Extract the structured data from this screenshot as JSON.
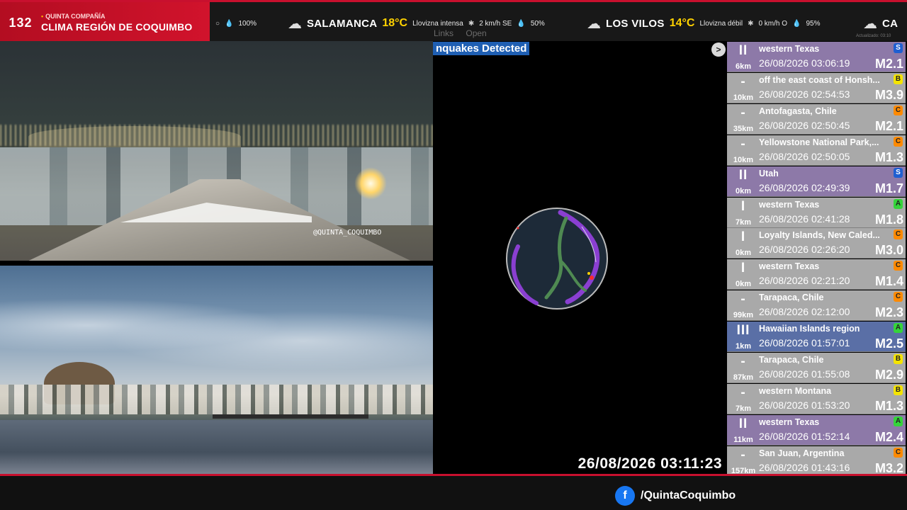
{
  "brand": {
    "channel_number": "132",
    "org": "QUINTA COMPAÑÍA",
    "title": "CLIMA REGIÓN DE COQUIMBO"
  },
  "ticker": [
    {
      "city": "",
      "temp": "",
      "condition": "",
      "wind": "",
      "humidity": "100%"
    },
    {
      "city": "SALAMANCA",
      "temp": "18°C",
      "condition": "Llovizna intensa",
      "wind": "2 km/h SE",
      "humidity": "50%"
    },
    {
      "city": "LOS VILOS",
      "temp": "14°C",
      "condition": "Llovizna débil",
      "wind": "0 km/h O",
      "humidity": "95%"
    },
    {
      "city": "CA",
      "temp": "",
      "condition": "",
      "wind": "",
      "humidity": ""
    }
  ],
  "cameras": {
    "cam1_watermark": "@QUINTA_COQUIMBO"
  },
  "quake_panel": {
    "links": [
      "Links",
      "Open"
    ],
    "banner": "nquakes Detected",
    "next_button": ">",
    "datetime": "26/08/2026 03:11:23",
    "updated_note": "Actualizado: 03:10"
  },
  "quakes": [
    {
      "intensity": "II",
      "depth": "6km",
      "location": "western Texas",
      "time": "26/08/2026 03:06:19",
      "magnitude": "M2.1",
      "badge": "S",
      "badge_color": "#1f5fd1",
      "row_color": "pur"
    },
    {
      "intensity": "-",
      "depth": "10km",
      "location": "off the east coast of Honsh...",
      "time": "26/08/2026 02:54:53",
      "magnitude": "M3.9",
      "badge": "B",
      "badge_color": "#f4e400",
      "row_color": "gry"
    },
    {
      "intensity": "-",
      "depth": "35km",
      "location": "Antofagasta, Chile",
      "time": "26/08/2026 02:50:45",
      "magnitude": "M2.1",
      "badge": "C",
      "badge_color": "#ff8a00",
      "row_color": "gry"
    },
    {
      "intensity": "-",
      "depth": "10km",
      "location": "Yellowstone National Park,...",
      "time": "26/08/2026 02:50:05",
      "magnitude": "M1.3",
      "badge": "C",
      "badge_color": "#ff8a00",
      "row_color": "gry"
    },
    {
      "intensity": "II",
      "depth": "0km",
      "location": "Utah",
      "time": "26/08/2026 02:49:39",
      "magnitude": "M1.7",
      "badge": "S",
      "badge_color": "#1f5fd1",
      "row_color": "pur"
    },
    {
      "intensity": "I",
      "depth": "7km",
      "location": "western Texas",
      "time": "26/08/2026 02:41:28",
      "magnitude": "M1.8",
      "badge": "A",
      "badge_color": "#35d43a",
      "row_color": "gry"
    },
    {
      "intensity": "I",
      "depth": "0km",
      "location": "Loyalty Islands, New Caled...",
      "time": "26/08/2026 02:26:20",
      "magnitude": "M3.0",
      "badge": "C",
      "badge_color": "#ff8a00",
      "row_color": "gry"
    },
    {
      "intensity": "I",
      "depth": "0km",
      "location": "western Texas",
      "time": "26/08/2026 02:21:20",
      "magnitude": "M1.4",
      "badge": "C",
      "badge_color": "#ff8a00",
      "row_color": "gry"
    },
    {
      "intensity": "-",
      "depth": "99km",
      "location": "Tarapaca, Chile",
      "time": "26/08/2026 02:12:00",
      "magnitude": "M2.3",
      "badge": "C",
      "badge_color": "#ff8a00",
      "row_color": "gry"
    },
    {
      "intensity": "III",
      "depth": "1km",
      "location": "Hawaiian Islands region",
      "time": "26/08/2026 01:57:01",
      "magnitude": "M2.5",
      "badge": "A",
      "badge_color": "#35d43a",
      "row_color": "blu"
    },
    {
      "intensity": "-",
      "depth": "87km",
      "location": "Tarapaca, Chile",
      "time": "26/08/2026 01:55:08",
      "magnitude": "M2.9",
      "badge": "B",
      "badge_color": "#f4e400",
      "row_color": "gry"
    },
    {
      "intensity": "-",
      "depth": "7km",
      "location": "western Montana",
      "time": "26/08/2026 01:53:20",
      "magnitude": "M1.3",
      "badge": "B",
      "badge_color": "#f4e400",
      "row_color": "gry"
    },
    {
      "intensity": "II",
      "depth": "11km",
      "location": "western Texas",
      "time": "26/08/2026 01:52:14",
      "magnitude": "M2.4",
      "badge": "A",
      "badge_color": "#35d43a",
      "row_color": "pur"
    },
    {
      "intensity": "-",
      "depth": "157km",
      "location": "San Juan, Argentina",
      "time": "26/08/2026 01:43:16",
      "magnitude": "M3.2",
      "badge": "C",
      "badge_color": "#ff8a00",
      "row_color": "gry"
    }
  ],
  "footer": {
    "facebook_icon": "facebook-icon",
    "facebook_handle": "/QuintaCoquimbo"
  }
}
